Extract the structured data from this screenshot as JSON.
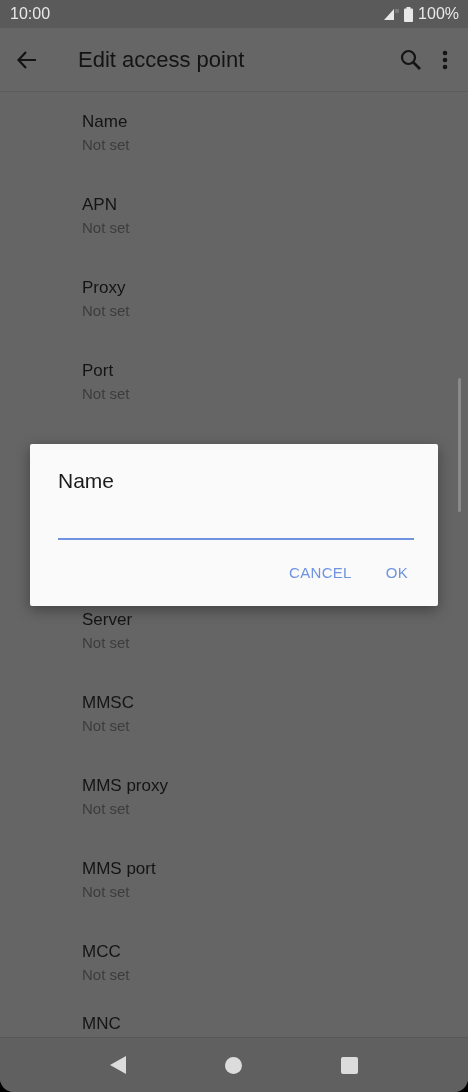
{
  "status_bar": {
    "time": "10:00",
    "battery": "100%"
  },
  "toolbar": {
    "title": "Edit access point"
  },
  "settings": [
    {
      "label": "Name",
      "value": "Not set"
    },
    {
      "label": "APN",
      "value": "Not set"
    },
    {
      "label": "Proxy",
      "value": "Not set"
    },
    {
      "label": "Port",
      "value": "Not set"
    },
    {
      "label": "Server",
      "value": "Not set"
    },
    {
      "label": "MMSC",
      "value": "Not set"
    },
    {
      "label": "MMS proxy",
      "value": "Not set"
    },
    {
      "label": "MMS port",
      "value": "Not set"
    },
    {
      "label": "MCC",
      "value": "Not set"
    },
    {
      "label": "MNC"
    }
  ],
  "dialog": {
    "title": "Name",
    "buttons": [
      "CANCEL",
      "OK"
    ]
  }
}
